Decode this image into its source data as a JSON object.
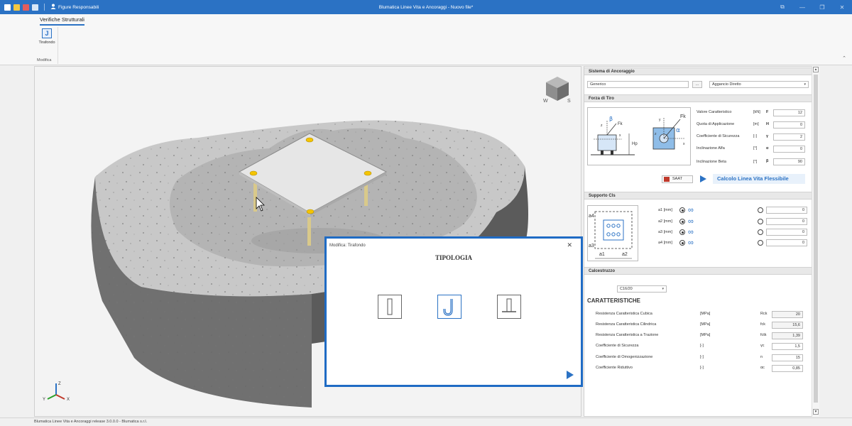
{
  "app": {
    "title": "Blumatica Linee Vita e Ancoraggi - Nuovo file*",
    "user_label": "Figure Responsabili",
    "window_controls": [
      "restore-down-icon",
      "minimize-icon",
      "maximize-icon",
      "close-icon"
    ]
  },
  "ribbon": {
    "tab": "Verifiche Strutturali",
    "buttons": [
      {
        "label": "Tirafondo",
        "icon": "j-bolt-icon"
      }
    ],
    "group_label": "Modifica"
  },
  "viewport": {
    "navcube_labels": [
      "W",
      "S"
    ],
    "axis_labels": [
      "Y",
      "Z",
      "X"
    ]
  },
  "dialog": {
    "header": "Modifica: Tirafondo",
    "title": "TIPOLOGIA",
    "options": [
      "straight-bolt-icon",
      "j-bolt-icon",
      "plate-bolt-icon"
    ],
    "selected_index": 1
  },
  "panel": {
    "sistema": {
      "title": "Sistema di Ancoraggio",
      "field_value": "Generico",
      "dots_label": "...",
      "dropdown_value": "Aggancio Diretto"
    },
    "forza": {
      "title": "Forza di Tiro",
      "figure_labels": {
        "beta": "β",
        "fk": "Fk",
        "z": "z",
        "x": "x",
        "y": "y",
        "hp": "Hp",
        "alpha": "α"
      },
      "rows": [
        {
          "label": "Valore Caratteristico",
          "unit": "[kN]",
          "symbol": "F",
          "value": "12"
        },
        {
          "label": "Quota di Applicazione",
          "unit": "[m]",
          "symbol": "H",
          "value": "0"
        },
        {
          "label": "Coefficiente di Sicurezza",
          "unit": "[-]",
          "symbol": "γ",
          "value": "2"
        },
        {
          "label": "Inclinazione Alfa",
          "unit": "[°]",
          "symbol": "α",
          "value": "0"
        },
        {
          "label": "Inclinazione Beta",
          "unit": "[°]",
          "symbol": "β",
          "value": "90"
        }
      ],
      "saat_label": "SAAT",
      "calc_label": "Calcolo Linea Vita Flessibile"
    },
    "supporto": {
      "title": "Supporto Cls",
      "figure_labels": {
        "a4": "a4",
        "a3": "a3",
        "a1": "a1",
        "a2": "a2"
      },
      "rows": [
        {
          "label": "a1 [mm]",
          "value": "0"
        },
        {
          "label": "a2 [mm]",
          "value": "0"
        },
        {
          "label": "a3 [mm]",
          "value": "0"
        },
        {
          "label": "a4 [mm]",
          "value": "0"
        }
      ]
    },
    "cls": {
      "title": "Calcestruzzo",
      "dropdown_value": "C16/20",
      "caratt_title": "CARATTERISTICHE",
      "rows": [
        {
          "label": "Resistenza Caratteristica Cubica",
          "unit": "[MPa]",
          "symbol": "Rck",
          "value": "20"
        },
        {
          "label": "Resistenza Caratteristica Cilindrica",
          "unit": "[MPa]",
          "symbol": "fck",
          "value": "15,6"
        },
        {
          "label": "Resistenza Caratteristica a Trazione",
          "unit": "[MPa]",
          "symbol": "fctk",
          "value": "1,39"
        },
        {
          "label": "Coefficiente di Sicurezza",
          "unit": "[-]",
          "symbol": "γc",
          "value": "1,5"
        },
        {
          "label": "Coefficiente di Omogenizzazione",
          "unit": "[-]",
          "symbol": "n",
          "value": "15"
        },
        {
          "label": "Coefficiente Riduttivo",
          "unit": "[-]",
          "symbol": "αc",
          "value": "0,85"
        }
      ]
    }
  },
  "status": "Blumatica Linee Vita e Ancoraggi release 3.0.0.0 - Blumatica s.r.l."
}
